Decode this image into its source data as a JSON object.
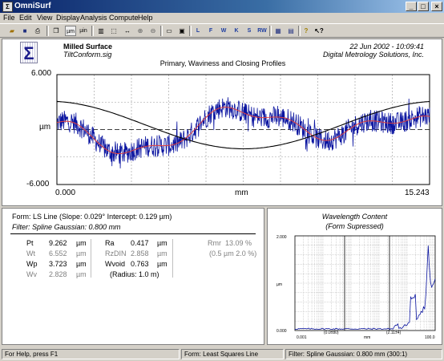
{
  "window": {
    "title": "OmniSurf"
  },
  "menu": [
    "File",
    "Edit",
    "View",
    "Display",
    "Analysis",
    "Compute",
    "Help"
  ],
  "toolbar": {
    "unit_um": "µm",
    "unit_uin": "µin",
    "g_l": "L",
    "g_f": "F",
    "g_w": "W",
    "g_k": "K",
    "g_s": "S",
    "g_rw": "RW"
  },
  "header": {
    "title": "Milled Surface",
    "file": "TiltConform.sig",
    "datetime": "22 Jun 2002 - 10:09:41",
    "company": "Digital Metrology Solutions, Inc.",
    "plot_title": "Primary, Waviness and Closing Profiles"
  },
  "profile_plot": {
    "y_top": "6.000",
    "y_unit": "µm",
    "y_bottom": "-6.000",
    "x_left": "0.000",
    "x_unit": "mm",
    "x_right": "15.243",
    "colors": {
      "primary": "#0a14a0",
      "waviness": "#e04040",
      "closing": "#000000"
    }
  },
  "results": {
    "form_line": "Form: LS Line   (Slope: 0.029°  Intercept: 0.129 µm)",
    "filter_line": "Filter: Spline Gaussian: 0.800 mm",
    "params": [
      {
        "name": "Pt",
        "value": "9.262",
        "unit": "µm",
        "dim": false
      },
      {
        "name": "Wt",
        "value": "6.552",
        "unit": "µm",
        "dim": true
      },
      {
        "name": "Wp",
        "value": "3.723",
        "unit": "µm",
        "dim": false
      },
      {
        "name": "Wv",
        "value": "2.828",
        "unit": "µm",
        "dim": true
      }
    ],
    "params2": [
      {
        "name": "Ra",
        "value": "0.417",
        "unit": "µm",
        "dim": false
      },
      {
        "name": "RzDIN",
        "value": "2.858",
        "unit": "µm",
        "dim": true
      },
      {
        "name": "Wvoid",
        "value": "0.763",
        "unit": "µm",
        "dim": false
      }
    ],
    "radius": "(Radius: 1.0 m)",
    "rmr_name": "Rmr",
    "rmr_value": "13.09",
    "rmr_unit": "%",
    "rmr_note": "(0.5 µm  2.0 %)"
  },
  "wavelength": {
    "title": "Wavelength Content",
    "subtitle": "(Form Supressed)",
    "y_top": "2.000",
    "y_unit": "µm",
    "y_bottom": "0.000",
    "x_left": "0.001",
    "x_mid": "mm",
    "x_right": "100.0",
    "marker1": "(0.0±80)",
    "marker2": "(2.11±4)"
  },
  "status": {
    "help": "For Help, press F1",
    "form": "Form: Least Squares Line",
    "filter": "Filter: Spline Gaussian: 0.800 mm (300:1)"
  }
}
